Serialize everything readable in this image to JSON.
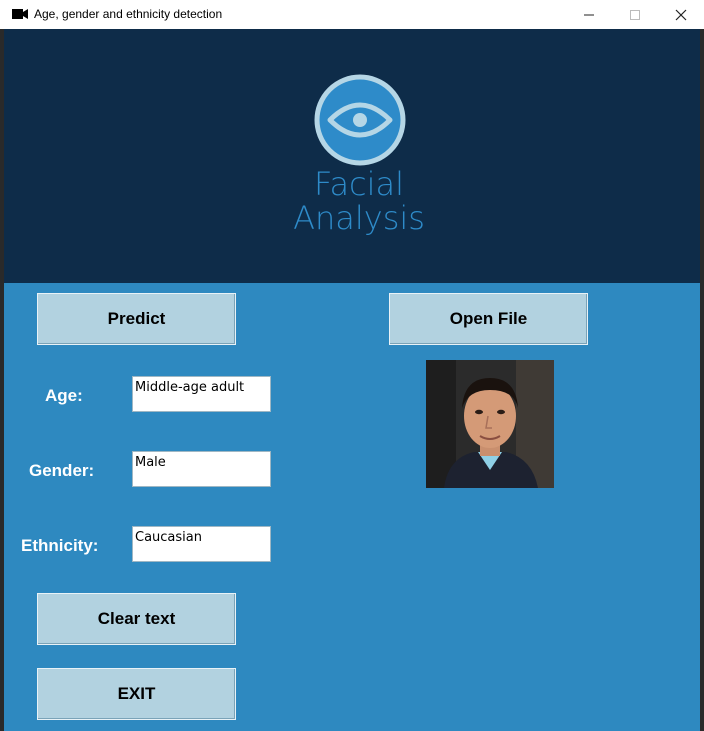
{
  "window": {
    "title": "Age, gender and ethnicity detection",
    "minimize": "—",
    "maximize": "☐",
    "close": "✕"
  },
  "logo": {
    "line1": "Facial",
    "line2": "Analysis",
    "color": "#2e8bc9",
    "icon": "eye-icon"
  },
  "buttons": {
    "predict": "Predict",
    "open_file": "Open File",
    "clear_text": "Clear text",
    "exit": "EXIT"
  },
  "fields": {
    "age_label": "Age:",
    "age_value": "Middle-age adult",
    "gender_label": "Gender:",
    "gender_value": "Male",
    "ethnicity_label": "Ethnicity:",
    "ethnicity_value": "Caucasian"
  },
  "colors": {
    "header_bg": "#0e2c49",
    "main_bg": "#2e89c0",
    "button_bg": "#b2d2e0"
  }
}
